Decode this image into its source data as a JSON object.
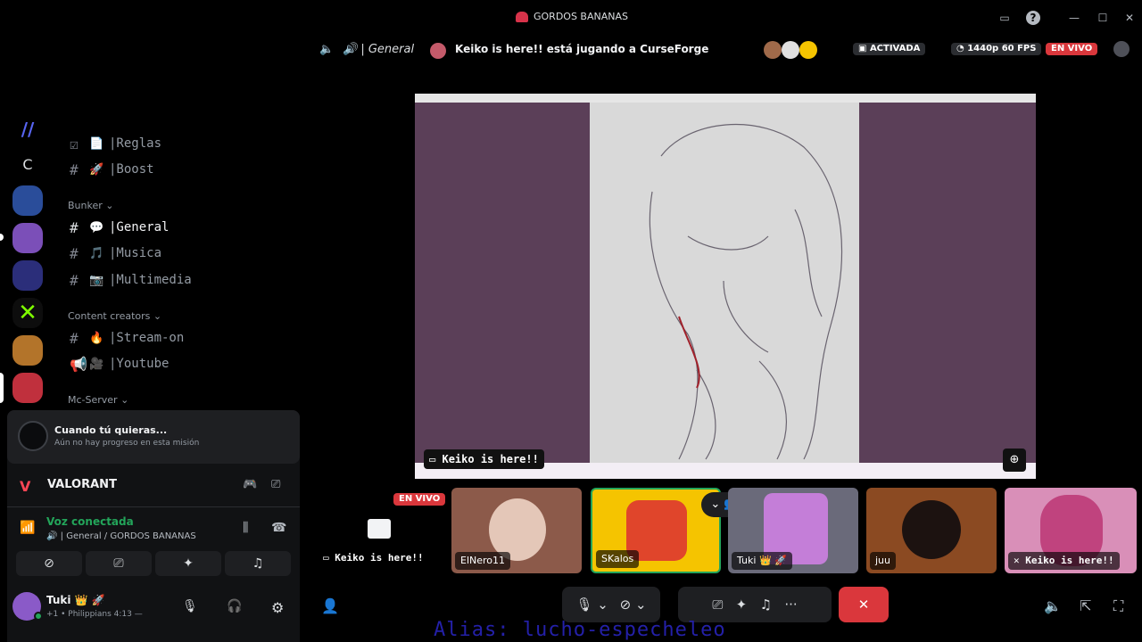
{
  "window": {
    "title": "GORDOS BANANAS"
  },
  "rail": {
    "server_letter": "C"
  },
  "channels": {
    "items": [
      {
        "emoji": "📄",
        "name": "|Reglas"
      },
      {
        "emoji": "🚀",
        "name": "|Boost"
      },
      {
        "emoji": "💬",
        "name": "|General"
      },
      {
        "emoji": "🎵",
        "name": "|Musica"
      },
      {
        "emoji": "📷",
        "name": "|Multimedia"
      },
      {
        "emoji": "🔥",
        "name": "|Stream-on"
      },
      {
        "emoji": "🎥",
        "name": "|Youtube"
      }
    ],
    "categories": [
      "Bunker",
      "Content creators",
      "Mc-Server"
    ]
  },
  "quest": {
    "title": "Cuando tú quieras...",
    "subtitle": "Aún no hay progreso en esta misión"
  },
  "activity": {
    "game": "VALORANT"
  },
  "voice": {
    "status": "Voz conectada",
    "channel": "| General / GORDOS BANANAS"
  },
  "user": {
    "name": "Tuki 👑 🚀",
    "status": "+1 • Philippians 4:13 —"
  },
  "topbar": {
    "channel": "| General",
    "activity_text": "Keiko is here!! está jugando a CurseForge",
    "activated": "ACTIVADA",
    "quality": "1440p 60 FPS",
    "live": "EN VIVO"
  },
  "stream": {
    "nameplate": "Keiko is here!!"
  },
  "tiles": {
    "live_label": "EN VIVO",
    "self_stream_label": "Keiko is here!!",
    "people": [
      {
        "name": "ElNero11"
      },
      {
        "name": "SKalos"
      },
      {
        "name": "Tuki 👑 🚀"
      },
      {
        "name": "juu"
      },
      {
        "name": "Keiko is here!!"
      }
    ]
  },
  "overlay": {
    "alias": "Alias: lucho-especheleo"
  },
  "colors": {
    "accent_green": "#23a55a",
    "danger": "#da373c",
    "live": "#da373c",
    "bg": "#000000"
  }
}
